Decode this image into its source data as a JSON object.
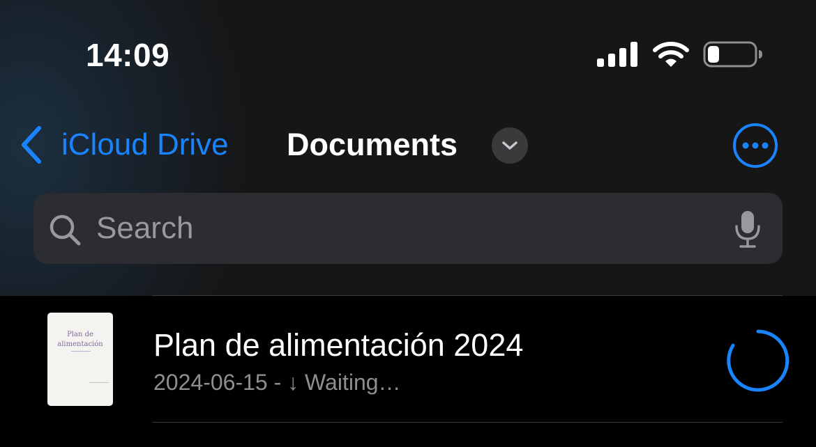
{
  "status_bar": {
    "time": "14:09",
    "signal_bars": 4,
    "battery_level": 0.2
  },
  "nav": {
    "back_label": "iCloud Drive",
    "title": "Documents",
    "accent_color": "#1a84ff"
  },
  "search": {
    "placeholder": "Search"
  },
  "files": [
    {
      "name": "Plan de alimentación 2024",
      "meta": "2024-06-15 - ↓ Waiting…",
      "thumbnail_text": [
        "Plan de",
        "alimentación"
      ],
      "status_icon": "loading-spinner-icon"
    }
  ]
}
